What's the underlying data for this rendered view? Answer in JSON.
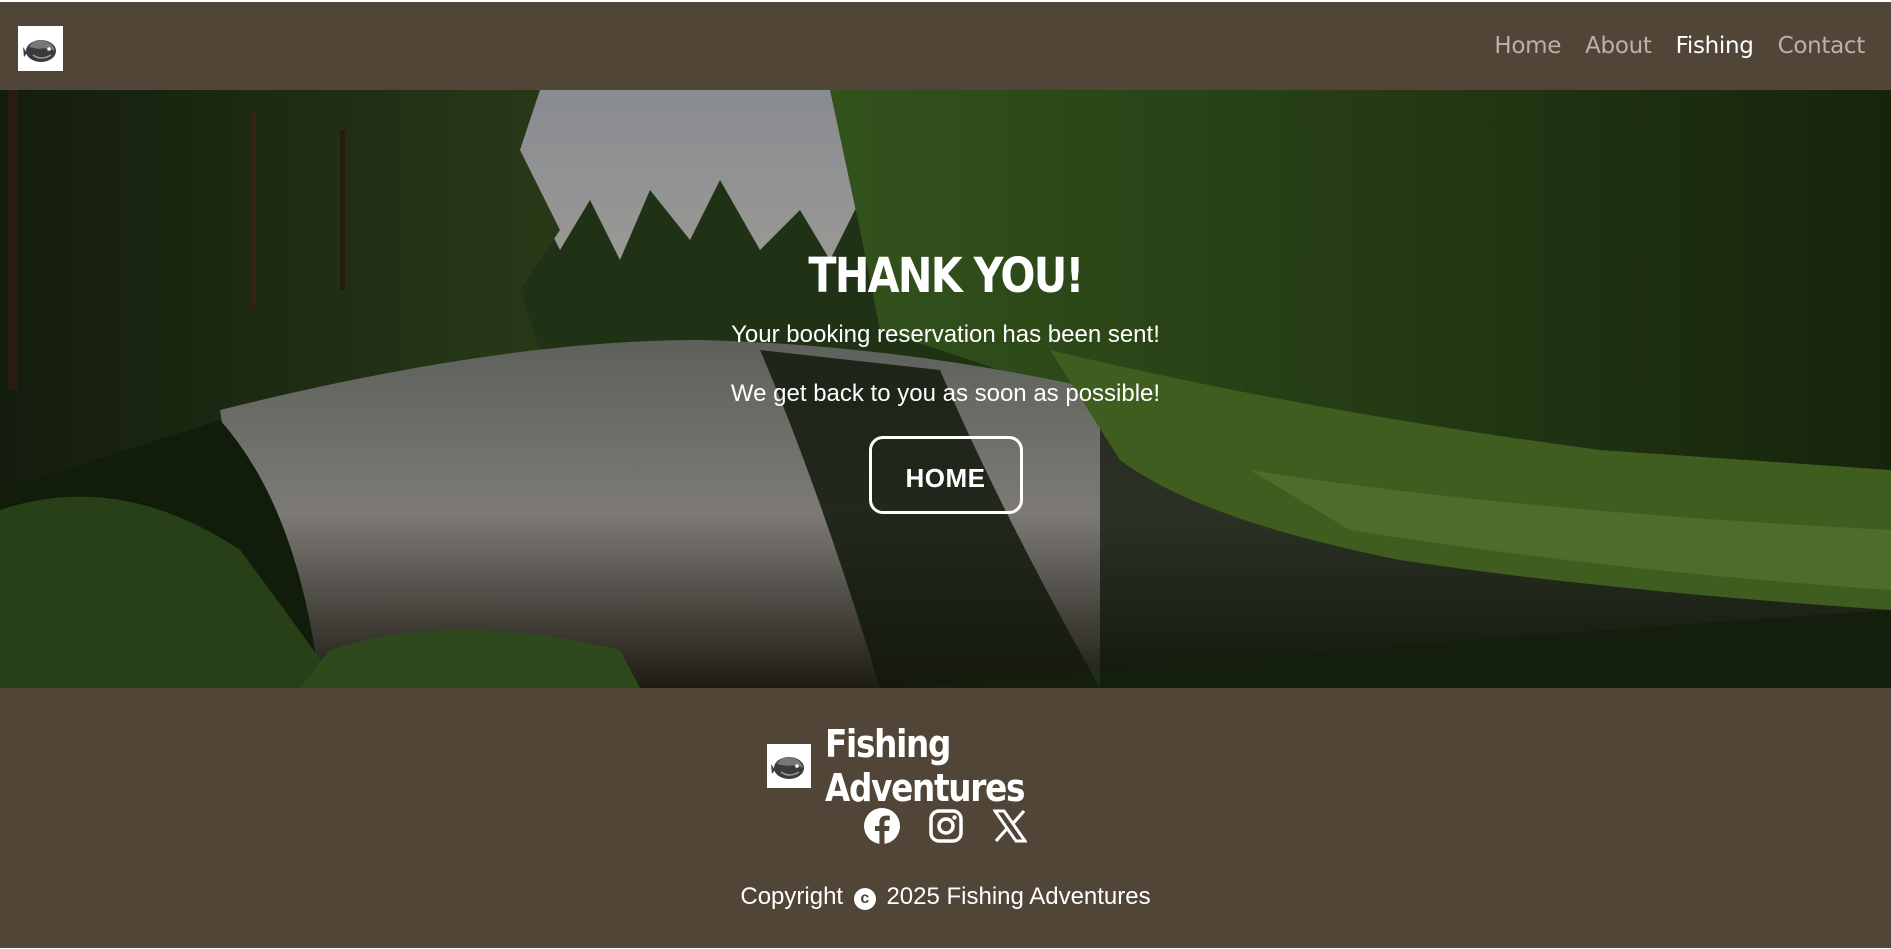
{
  "nav": {
    "logo_icon": "fish-logo-icon",
    "links": [
      {
        "label": "Home",
        "active": false
      },
      {
        "label": "About",
        "active": false
      },
      {
        "label": "Fishing",
        "active": true
      },
      {
        "label": "Contact",
        "active": false
      }
    ]
  },
  "hero": {
    "title": "THANK YOU!",
    "line1": "Your booking reservation has been sent!",
    "line2": "We get back to you as soon as possible!",
    "button_label": "HOME",
    "background": "forest-river-photo"
  },
  "footer": {
    "brand_name": "Fishing Adventures",
    "social": [
      "facebook-icon",
      "instagram-icon",
      "x-icon"
    ],
    "copyright_prefix": "Copyright",
    "copyright_symbol": "c",
    "copyright_suffix": "2025 Fishing Adventures"
  },
  "colors": {
    "brown_bar": "#514537",
    "nav_inactive": "#b9b2a8",
    "white": "#ffffff"
  }
}
